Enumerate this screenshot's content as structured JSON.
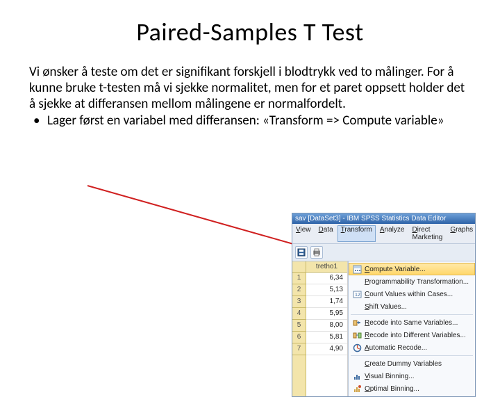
{
  "title": "Paired-Samples T Test",
  "paragraph": "Vi ønsker å teste om det er signifikant forskjell i blodtrykk ved to målinger. For å kunne bruke t-testen må vi sjekke normalitet, men for et paret oppsett holder det å sjekke at differansen mellom målingene er normalfordelt.",
  "bullet": "Lager først en variabel med differansen: «Transform => Compute variable»",
  "spss": {
    "titlebar": "sav [DataSet3] - IBM SPSS Statistics Data Editor",
    "menus": [
      "View",
      "Data",
      "Transform",
      "Analyze",
      "Direct Marketing",
      "Graphs"
    ],
    "active_menu_index": 2,
    "toolbar_icons": [
      "save-icon",
      "print-icon"
    ],
    "data_header": "tretho1",
    "row_nums": [
      "1",
      "2",
      "3",
      "4",
      "5",
      "6",
      "7"
    ],
    "data_values": [
      "6,34",
      "5,13",
      "1,74",
      "5,95",
      "8,00",
      "5,81",
      "4,90"
    ],
    "dropdown": [
      {
        "label": "Compute Variable...",
        "icon": "compute-icon",
        "highlight": true
      },
      {
        "label": "Programmability Transformation...",
        "icon": ""
      },
      {
        "label": "Count Values within Cases...",
        "icon": "count-icon"
      },
      {
        "label": "Shift Values...",
        "icon": ""
      },
      {
        "sep": true
      },
      {
        "label": "Recode into Same Variables...",
        "icon": "recode-same-icon"
      },
      {
        "label": "Recode into Different Variables...",
        "icon": "recode-diff-icon"
      },
      {
        "label": "Automatic Recode...",
        "icon": "auto-recode-icon"
      },
      {
        "sep": true
      },
      {
        "label": "Create Dummy Variables",
        "icon": ""
      },
      {
        "label": "Visual Binning...",
        "icon": "visual-bin-icon"
      },
      {
        "label": "Optimal Binning...",
        "icon": "optimal-bin-icon"
      }
    ]
  }
}
